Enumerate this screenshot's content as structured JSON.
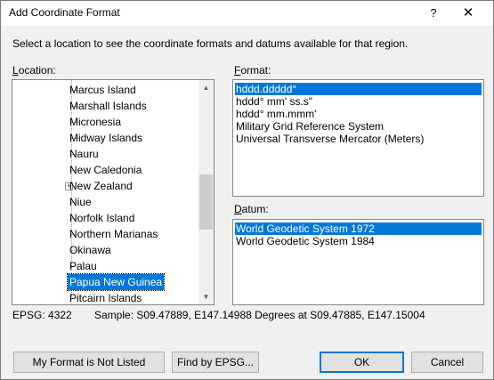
{
  "window": {
    "title": "Add Coordinate Format",
    "help_glyph": "?",
    "close_glyph": "✕"
  },
  "instruction": "Select a location to see the coordinate formats and datums available for that region.",
  "location": {
    "label_prefix": "",
    "label_underlined": "L",
    "label_rest": "ocation:",
    "items": [
      {
        "label": "Marcus Island",
        "expandable": false,
        "selected": false
      },
      {
        "label": "Marshall Islands",
        "expandable": false,
        "selected": false
      },
      {
        "label": "Micronesia",
        "expandable": false,
        "selected": false
      },
      {
        "label": "Midway Islands",
        "expandable": false,
        "selected": false
      },
      {
        "label": "Nauru",
        "expandable": false,
        "selected": false
      },
      {
        "label": "New Caledonia",
        "expandable": false,
        "selected": false
      },
      {
        "label": "New Zealand",
        "expandable": true,
        "selected": false
      },
      {
        "label": "Niue",
        "expandable": false,
        "selected": false
      },
      {
        "label": "Norfolk Island",
        "expandable": false,
        "selected": false
      },
      {
        "label": "Northern Marianas",
        "expandable": false,
        "selected": false
      },
      {
        "label": "Okinawa",
        "expandable": false,
        "selected": false
      },
      {
        "label": "Palau",
        "expandable": false,
        "selected": false
      },
      {
        "label": "Papua New Guinea",
        "expandable": false,
        "selected": true
      },
      {
        "label": "Pitcairn Islands",
        "expandable": false,
        "selected": false
      }
    ],
    "expander_glyph": "+",
    "scroll_up_glyph": "▲",
    "scroll_down_glyph": "▼"
  },
  "format": {
    "label_underlined": "F",
    "label_rest": "ormat:",
    "items": [
      {
        "label": "hddd.ddddd°",
        "selected": true
      },
      {
        "label": "hddd° mm' ss.s\"",
        "selected": false
      },
      {
        "label": "hddd° mm.mmm'",
        "selected": false
      },
      {
        "label": "Military Grid Reference System",
        "selected": false
      },
      {
        "label": "Universal Transverse Mercator (Meters)",
        "selected": false
      }
    ]
  },
  "datum": {
    "label_underlined": "D",
    "label_rest": "atum:",
    "items": [
      {
        "label": "World Geodetic System 1972",
        "selected": true
      },
      {
        "label": "World Geodetic System 1984",
        "selected": false
      }
    ]
  },
  "status": {
    "epsg": "EPSG: 4322",
    "sample": "Sample: S09.47889, E147.14988 Degrees at S09.47885, E147.15004"
  },
  "buttons": {
    "not_listed": "My Format is Not Listed",
    "find_epsg": "Find by EPSG...",
    "ok": "OK",
    "cancel": "Cancel"
  }
}
